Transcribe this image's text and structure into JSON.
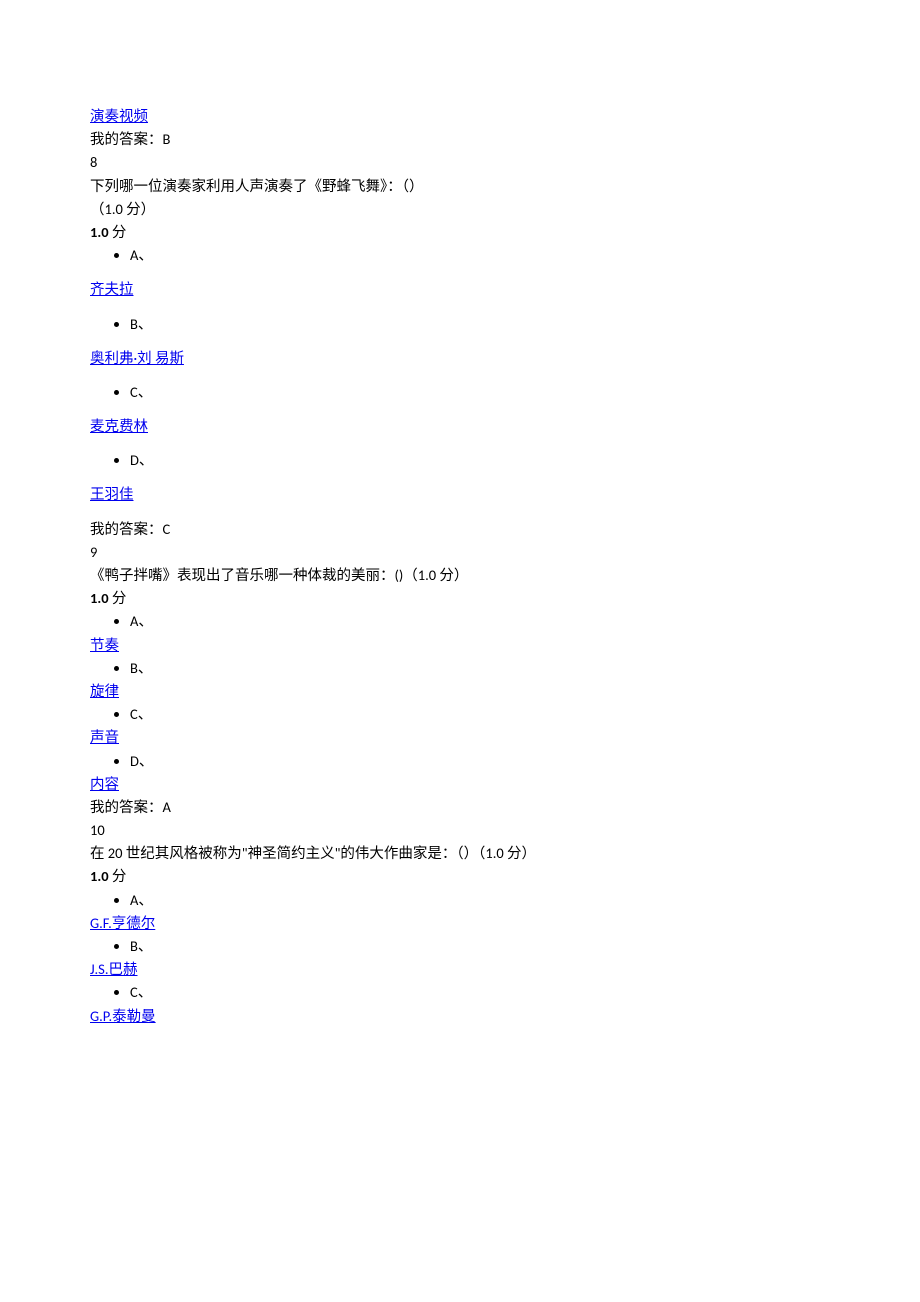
{
  "q7_tail": {
    "link": "演奏视频",
    "my_answer_label": "我的答案：",
    "my_answer_value": "B"
  },
  "q8": {
    "number": "8",
    "text": "下列哪一位演奏家利用人声演奏了《野蜂飞舞》：（）",
    "points_line": "（1.0 分）",
    "score": "1.0",
    "score_unit": " 分",
    "opt_a_label": "A、",
    "opt_a_text": "齐夫拉",
    "opt_b_label": "B、",
    "opt_b_text": "奥利弗·刘  易斯",
    "opt_c_label": "C、",
    "opt_c_text": "麦克费林",
    "opt_d_label": "D、",
    "opt_d_text": "王羽佳",
    "my_answer_label": "我的答案：",
    "my_answer_value": "C"
  },
  "q9": {
    "number": "9",
    "text": "《鸭子拌嘴》表现出了音乐哪一种体裁的美丽：()（1.0 分）",
    "score": "1.0",
    "score_unit": " 分",
    "opt_a_label": "A、",
    "opt_a_text": "节奏",
    "opt_b_label": "B、",
    "opt_b_text": "旋律",
    "opt_c_label": "C、",
    "opt_c_text": "声音",
    "opt_d_label": "D、",
    "opt_d_text": "内容",
    "my_answer_label": "我的答案：",
    "my_answer_value": "A"
  },
  "q10": {
    "number": "10",
    "text": "在 20 世纪其风格被称为\"神圣简约主义\"的伟大作曲家是：（）（1.0 分）",
    "score": "1.0",
    "score_unit": " 分",
    "opt_a_label": "A、",
    "opt_a_text": "G.F.亨德尔",
    "opt_b_label": "B、",
    "opt_b_text": "J.S.巴赫",
    "opt_c_label": "C、",
    "opt_c_text": "G.P.泰勒曼"
  }
}
